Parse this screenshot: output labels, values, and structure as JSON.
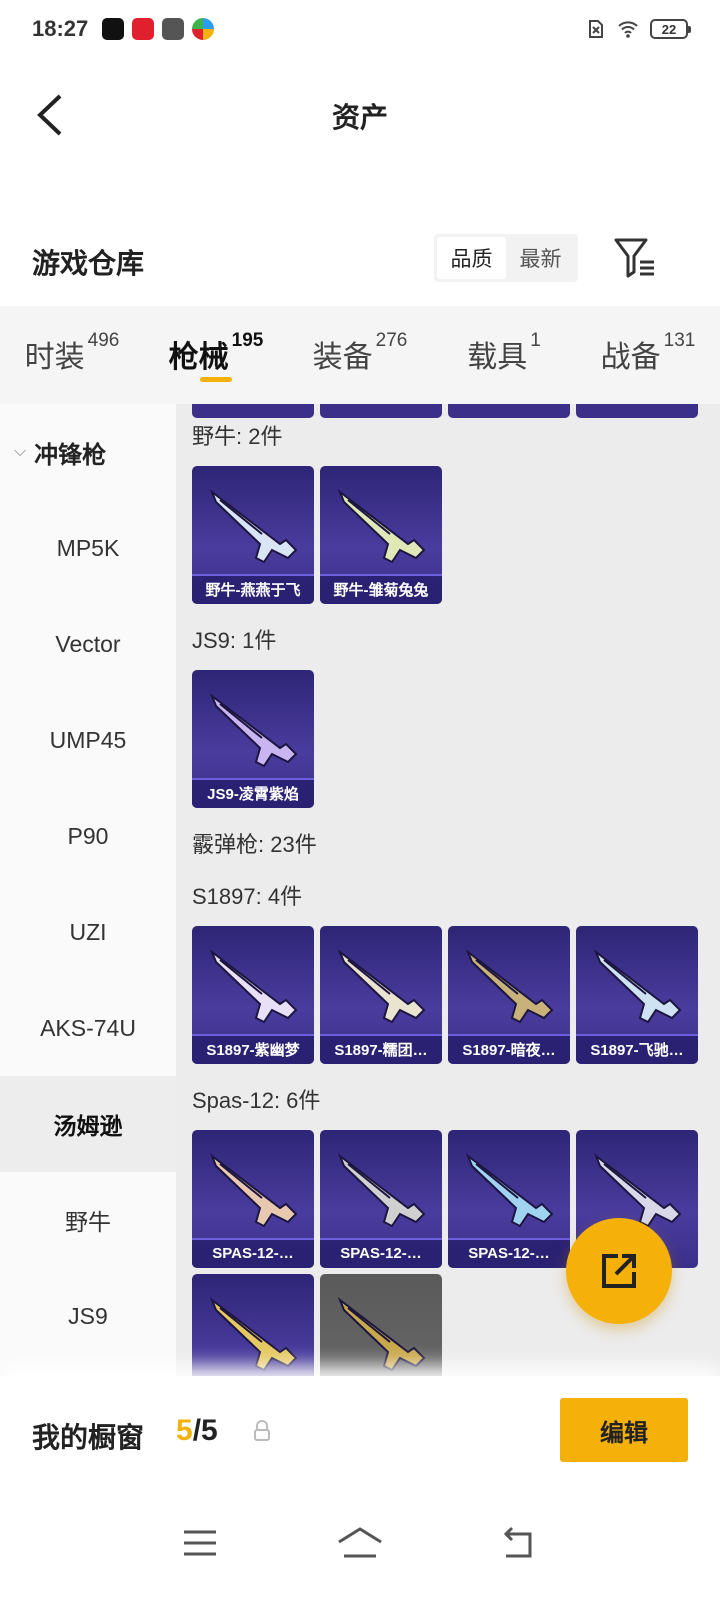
{
  "status_bar": {
    "time": "18:27",
    "apps": [
      {
        "name": "douyin-app-icon",
        "color": "#111111"
      },
      {
        "name": "tmall-app-icon",
        "color": "#e0202d"
      },
      {
        "name": "card-app-icon",
        "color": "#444444"
      },
      {
        "name": "browser-app-icon",
        "color": "#2a9df4"
      }
    ],
    "battery": "22"
  },
  "header": {
    "title": "资产"
  },
  "section": {
    "title": "游戏仓库",
    "sort_options": [
      {
        "label": "品质",
        "active": true
      },
      {
        "label": "最新",
        "active": false
      }
    ]
  },
  "tabs": [
    {
      "label": "时装",
      "count": "496",
      "active": false
    },
    {
      "label": "枪械",
      "count": "195",
      "active": true
    },
    {
      "label": "装备",
      "count": "276",
      "active": false
    },
    {
      "label": "载具",
      "count": "1",
      "active": false
    },
    {
      "label": "战备",
      "count": "131",
      "active": false
    }
  ],
  "sidebar": {
    "group": "冲锋枪",
    "items": [
      {
        "label": "MP5K",
        "active": false
      },
      {
        "label": "Vector",
        "active": false
      },
      {
        "label": "UMP45",
        "active": false
      },
      {
        "label": "P90",
        "active": false
      },
      {
        "label": "UZI",
        "active": false
      },
      {
        "label": "AKS-74U",
        "active": false
      },
      {
        "label": "汤姆逊",
        "active": true
      },
      {
        "label": "野牛",
        "active": false
      },
      {
        "label": "JS9",
        "active": false
      }
    ]
  },
  "content": {
    "groups": [
      {
        "title": "野牛: 2件",
        "cards": [
          {
            "label": "野牛-燕燕于飞",
            "gun_color": "#d9e4f5"
          },
          {
            "label": "野牛-雏菊兔兔",
            "gun_color": "#dfe8b6"
          }
        ]
      },
      {
        "title": "JS9: 1件",
        "cards": [
          {
            "label": "JS9-凌霄紫焰",
            "gun_color": "#c9b6f0"
          }
        ]
      },
      {
        "title": "霰弹枪: 23件",
        "cards": []
      },
      {
        "title": "S1897: 4件",
        "cards": [
          {
            "label": "S1897-紫幽梦",
            "gun_color": "#e8e0f5"
          },
          {
            "label": "S1897-糯团…",
            "gun_color": "#e9e4cf"
          },
          {
            "label": "S1897-暗夜…",
            "gun_color": "#c8b27a"
          },
          {
            "label": "S1897-飞驰…",
            "gun_color": "#cfe2f2"
          }
        ]
      },
      {
        "title": "Spas-12: 6件",
        "cards": [
          {
            "label": "SPAS-12-…",
            "gun_color": "#e8c9b0"
          },
          {
            "label": "SPAS-12-…",
            "gun_color": "#d0d0d0"
          },
          {
            "label": "SPAS-12-…",
            "gun_color": "#9fd3f0"
          },
          {
            "label": "",
            "gun_color": "#d8d8e8"
          },
          {
            "label": "",
            "gun_color": "#e5c860"
          },
          {
            "label": "",
            "gun_color": "#c9a84a",
            "gray": true
          }
        ]
      }
    ]
  },
  "showcase": {
    "label": "我的橱窗",
    "current": "5",
    "total": "/5",
    "edit_label": "编辑"
  },
  "colors": {
    "accent": "#f5b10a",
    "card_bg": "#3a2f88"
  }
}
